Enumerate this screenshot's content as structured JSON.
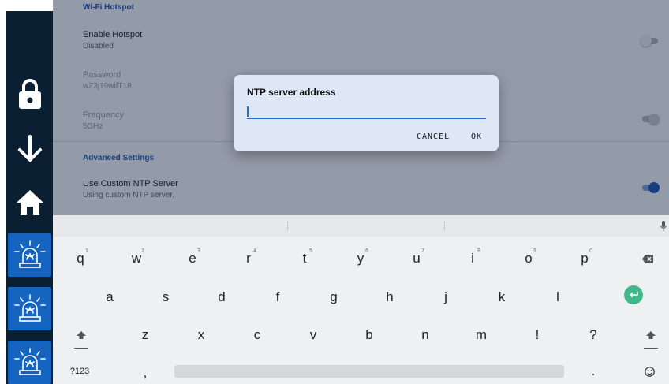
{
  "settings": {
    "partial_header": "Wi-Fi Hotspot",
    "enable_hotspot": {
      "title": "Enable Hotspot",
      "summary": "Disabled"
    },
    "password": {
      "title": "Password",
      "summary": "wZ3j19wifT18"
    },
    "frequency": {
      "title": "Frequency",
      "summary": "5GHz"
    },
    "advanced_header": "Advanced Settings",
    "custom_ntp": {
      "title": "Use Custom NTP Server",
      "summary": "Using custom NTP server."
    }
  },
  "dialog": {
    "title": "NTP server address",
    "input_value": "",
    "cancel_label": "CANCEL",
    "ok_label": "OK"
  },
  "keyboard": {
    "row1": [
      {
        "key": "q",
        "hint": "1"
      },
      {
        "key": "w",
        "hint": "2"
      },
      {
        "key": "e",
        "hint": "3"
      },
      {
        "key": "r",
        "hint": "4"
      },
      {
        "key": "t",
        "hint": "5"
      },
      {
        "key": "y",
        "hint": "6"
      },
      {
        "key": "u",
        "hint": "7"
      },
      {
        "key": "i",
        "hint": "8"
      },
      {
        "key": "o",
        "hint": "9"
      },
      {
        "key": "p",
        "hint": "0"
      }
    ],
    "row2": [
      "a",
      "s",
      "d",
      "f",
      "g",
      "h",
      "j",
      "k",
      "l"
    ],
    "row3": [
      "z",
      "x",
      "c",
      "v",
      "b",
      "n",
      "m",
      "!",
      "?"
    ],
    "symbols_label": "?123",
    "comma_label": ",",
    "period_label": "."
  },
  "colors": {
    "rail": "#0b1f33",
    "accent": "#1a56b4",
    "alarm_tile": "#1565c0",
    "enter": "#3fb88a"
  },
  "icons": [
    "lock-icon",
    "arrow-down-icon",
    "home-icon",
    "alarm-light-icon",
    "mic-icon",
    "backspace-icon",
    "enter-icon",
    "shift-icon",
    "emoji-icon"
  ]
}
